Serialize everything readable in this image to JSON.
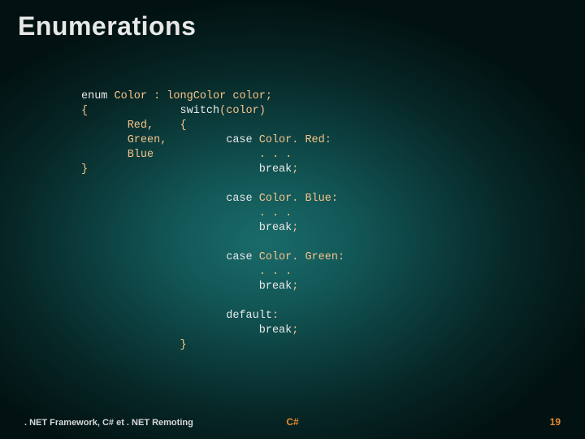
{
  "title": "Enumerations",
  "code": {
    "l1a": "enum",
    "l1b": " Color : long",
    "l1c": "Color color;",
    "l2a": "{              ",
    "l2b": "switch",
    "l2c": "(color)",
    "l3": "       Red,    {",
    "l4a": "       Green,         ",
    "l4b": "case",
    "l4c": " Color. Red:",
    "l5": "       Blue                . . .",
    "l6a": "}                          ",
    "l6b": "break",
    "l6c": ";",
    "sp1": "",
    "l7a": "                      ",
    "l7b": "case",
    "l7c": " Color. Blue:",
    "l8": "                           . . .",
    "l9a": "                           ",
    "l9b": "break",
    "l9c": ";",
    "sp2": "",
    "l10a": "                      ",
    "l10b": "case",
    "l10c": " Color. Green:",
    "l11": "                           . . .",
    "l12a": "                           ",
    "l12b": "break",
    "l12c": ";",
    "sp3": "",
    "l13a": "                      ",
    "l13b": "default",
    "l13c": ":",
    "l14a": "                           ",
    "l14b": "break",
    "l14c": ";",
    "l15": "               }"
  },
  "footer": {
    "left": ". NET Framework, C# et . NET Remoting",
    "center": "C#",
    "page": "19"
  }
}
